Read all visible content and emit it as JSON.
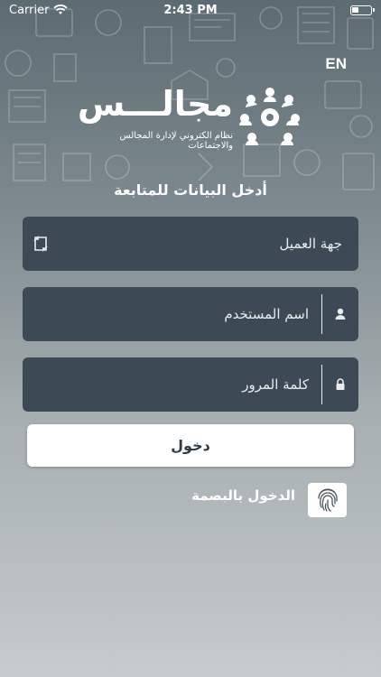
{
  "status_bar": {
    "carrier": "Carrier",
    "time": "2:43 PM"
  },
  "language_toggle": "EN",
  "logo": {
    "wordmark": "مجالـــس",
    "tagline": "نظام الكتروني لإدارة المجالس والاجتماعات"
  },
  "form": {
    "title": "أدخل البيانات للمتابعة",
    "client_placeholder": "جهة العميل",
    "username_placeholder": "اسم المستخدم",
    "password_placeholder": "كلمة المرور",
    "login_label": "دخول"
  },
  "fingerprint": {
    "label": "الدخول بالبصمة"
  },
  "colors": {
    "field_background": "#3d4a56",
    "button_background": "#ffffff"
  },
  "icons": {
    "client": "swap-icon",
    "username": "user-icon",
    "password": "lock-icon",
    "fingerprint": "fingerprint-icon"
  }
}
